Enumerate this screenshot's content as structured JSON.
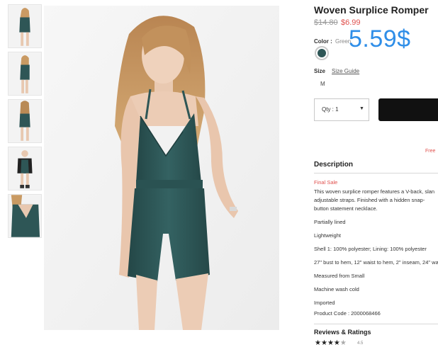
{
  "product": {
    "title": "Woven Surplice Romper",
    "price_old": "$14.80",
    "price_new": "$6.99",
    "overlay_price": "5.59$",
    "color_label": "Color :",
    "color_value": "Green",
    "swatch_color": "#2e5656",
    "size_label": "Size",
    "size_guide": "Size Guide",
    "size_option": "M",
    "qty_label": "Qty : 1",
    "qty_icon": "chevron-down-icon",
    "free_shipping": "Free",
    "description_heading": "Description",
    "final_sale": "Final Sale",
    "description_text": "This woven surplice romper features a V-back, slan adjustable straps. Finished with a hidden snap-button statement necklace.",
    "specs": [
      "Partially lined",
      "Lightweight",
      "Shell 1: 100% polyester; Lining: 100% polyester",
      "27\" bust to hem, 12\" waist to hem, 2\" inseam, 24\" wa",
      "Measured from Small",
      "Machine wash cold",
      "Imported",
      "Product Code : 2000068466"
    ],
    "reviews_heading": "Reviews & Ratings",
    "stars_icon": "star-icon",
    "stars_value": 4.5,
    "rating_text": "4.5"
  },
  "colors": {
    "sale": "#e0504d",
    "overlay": "#2f8ee8",
    "romper": "#2e5656"
  }
}
